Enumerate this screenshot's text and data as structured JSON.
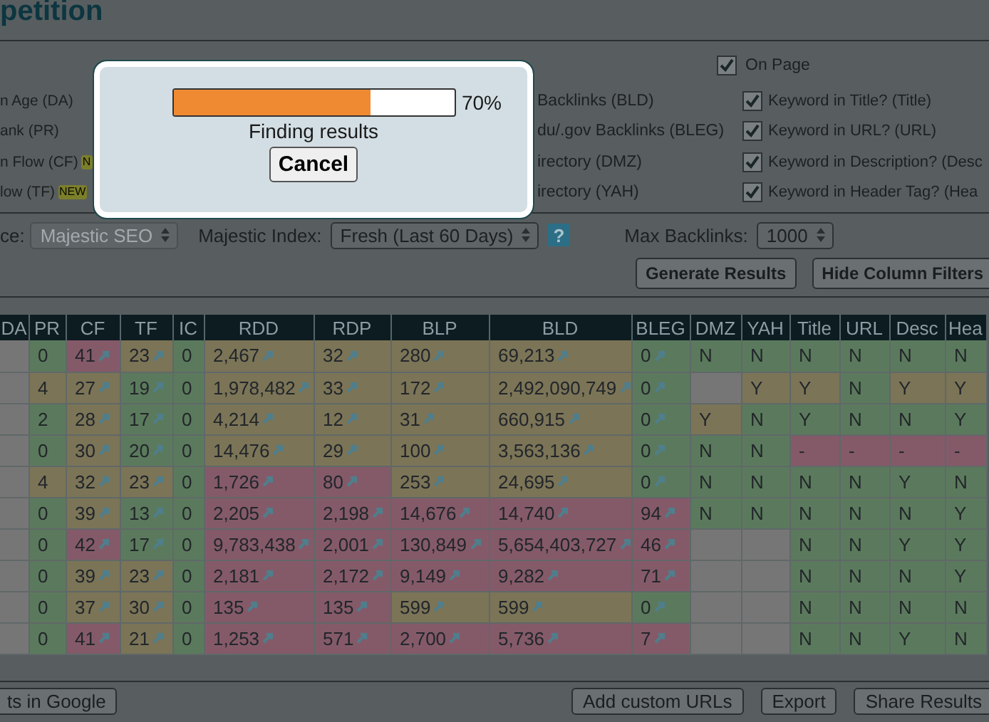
{
  "page": {
    "title": "petition"
  },
  "options": {
    "column_1": [
      {
        "label": "n Age (DA)"
      },
      {
        "label": "ank (PR)"
      },
      {
        "label": "n Flow (CF)",
        "badge": "N"
      },
      {
        "label": "low (TF)",
        "badge": "NEW"
      }
    ],
    "column_2": [
      {
        "label": "Backlinks (BLD)"
      },
      {
        "label": "du/.gov Backlinks (BLEG)"
      },
      {
        "label": "irectory (DMZ)"
      },
      {
        "label": "irectory (YAH)"
      }
    ],
    "on_page": {
      "label": "On Page",
      "checked": true,
      "items": [
        {
          "label": "Keyword in Title? (Title)",
          "checked": true
        },
        {
          "label": "Keyword in URL? (URL)",
          "checked": true
        },
        {
          "label": "Keyword in Description? (Desc",
          "checked": true
        },
        {
          "label": "Keyword in Header Tag? (Hea",
          "checked": true
        }
      ]
    }
  },
  "controls": {
    "source_label": "ce:",
    "source": {
      "value": "Majestic SEO",
      "disabled": true
    },
    "index_label": "Majestic Index:",
    "index": {
      "value": "Fresh (Last 60 Days)",
      "disabled": false
    },
    "help": "?",
    "max_label": "Max Backlinks:",
    "max": {
      "value": "1000",
      "disabled": false
    },
    "buttons": [
      "Generate Results",
      "Hide Column Filters"
    ]
  },
  "table": {
    "columns": [
      {
        "label": "DA"
      },
      {
        "label": "PR",
        "kind": "plain"
      },
      {
        "label": "CF",
        "kind": "link"
      },
      {
        "label": "TF",
        "kind": "link"
      },
      {
        "label": "IC",
        "kind": "plain"
      },
      {
        "label": "RDD",
        "kind": "link"
      },
      {
        "label": "RDP",
        "kind": "link"
      },
      {
        "label": "BLP",
        "kind": "link"
      },
      {
        "label": "BLD",
        "kind": "link"
      },
      {
        "label": "BLEG",
        "kind": "link"
      },
      {
        "label": "DMZ",
        "kind": "plain"
      },
      {
        "label": "YAH",
        "kind": "plain"
      },
      {
        "label": "Title",
        "kind": "plain"
      },
      {
        "label": "URL",
        "kind": "plain"
      },
      {
        "label": "Desc",
        "kind": "plain"
      },
      {
        "label": "Hea",
        "kind": "plain"
      }
    ],
    "rows": [
      {
        "cells": [
          {
            "color": "#767676"
          },
          {
            "text": "0",
            "color": "#5b7a5d"
          },
          {
            "text": "41",
            "color": "#845a69"
          },
          {
            "text": "23",
            "color": "#7b7457"
          },
          {
            "text": "0",
            "color": "#5b7a5d"
          },
          {
            "text": "2,467",
            "color": "#7b7457"
          },
          {
            "text": "32",
            "color": "#7b7457"
          },
          {
            "text": "280",
            "color": "#7b7457"
          },
          {
            "text": "69,213",
            "color": "#7b7457"
          },
          {
            "text": "0",
            "color": "#5b7a5d"
          },
          {
            "text": "N",
            "color": "#5b7a5d"
          },
          {
            "text": "N",
            "color": "#5b7a5d"
          },
          {
            "text": "N",
            "color": "#5b7a5d"
          },
          {
            "text": "N",
            "color": "#5b7a5d"
          },
          {
            "text": "N",
            "color": "#5b7a5d"
          },
          {
            "text": "N",
            "color": "#5b7a5d"
          }
        ]
      },
      {
        "cells": [
          {
            "color": "#767676"
          },
          {
            "text": "4",
            "color": "#7b7457"
          },
          {
            "text": "27",
            "color": "#7b7457"
          },
          {
            "text": "19",
            "color": "#5b7a5d"
          },
          {
            "text": "0",
            "color": "#5b7a5d"
          },
          {
            "text": "1,978,482",
            "color": "#7b7457"
          },
          {
            "text": "33",
            "color": "#7b7457"
          },
          {
            "text": "172",
            "color": "#7b7457"
          },
          {
            "text": "2,492,090,749",
            "color": "#7b7457"
          },
          {
            "text": "0",
            "color": "#5b7a5d"
          },
          {
            "color": "#767676"
          },
          {
            "text": "Y",
            "color": "#7b7457"
          },
          {
            "text": "Y",
            "color": "#7b7457"
          },
          {
            "text": "N",
            "color": "#5b7a5d"
          },
          {
            "text": "Y",
            "color": "#7b7457"
          },
          {
            "text": "Y",
            "color": "#7b7457"
          }
        ]
      },
      {
        "cells": [
          {
            "color": "#767676"
          },
          {
            "text": "2",
            "color": "#5b7a5d"
          },
          {
            "text": "28",
            "color": "#7b7457"
          },
          {
            "text": "17",
            "color": "#5b7a5d"
          },
          {
            "text": "0",
            "color": "#5b7a5d"
          },
          {
            "text": "4,214",
            "color": "#7b7457"
          },
          {
            "text": "12",
            "color": "#7b7457"
          },
          {
            "text": "31",
            "color": "#7b7457"
          },
          {
            "text": "660,915",
            "color": "#7b7457"
          },
          {
            "text": "0",
            "color": "#5b7a5d"
          },
          {
            "text": "Y",
            "color": "#7b7457"
          },
          {
            "text": "N",
            "color": "#5b7a5d"
          },
          {
            "text": "Y",
            "color": "#5b7a5d"
          },
          {
            "text": "N",
            "color": "#5b7a5d"
          },
          {
            "text": "N",
            "color": "#5b7a5d"
          },
          {
            "text": "Y",
            "color": "#5b7a5d"
          }
        ]
      },
      {
        "cells": [
          {
            "color": "#767676"
          },
          {
            "text": "0",
            "color": "#5b7a5d"
          },
          {
            "text": "30",
            "color": "#7b7457"
          },
          {
            "text": "20",
            "color": "#5b7a5d"
          },
          {
            "text": "0",
            "color": "#5b7a5d"
          },
          {
            "text": "14,476",
            "color": "#7b7457"
          },
          {
            "text": "29",
            "color": "#7b7457"
          },
          {
            "text": "100",
            "color": "#7b7457"
          },
          {
            "text": "3,563,136",
            "color": "#7b7457"
          },
          {
            "text": "0",
            "color": "#5b7a5d"
          },
          {
            "text": "N",
            "color": "#5b7a5d"
          },
          {
            "text": "N",
            "color": "#5b7a5d"
          },
          {
            "text": "-",
            "color": "#845a69"
          },
          {
            "text": "-",
            "color": "#845a69"
          },
          {
            "text": "-",
            "color": "#845a69"
          },
          {
            "text": "-",
            "color": "#845a69"
          }
        ]
      },
      {
        "cells": [
          {
            "color": "#767676"
          },
          {
            "text": "4",
            "color": "#7b7457"
          },
          {
            "text": "32",
            "color": "#7b7457"
          },
          {
            "text": "23",
            "color": "#7b7457"
          },
          {
            "text": "0",
            "color": "#5b7a5d"
          },
          {
            "text": "1,726",
            "color": "#845a69"
          },
          {
            "text": "80",
            "color": "#845a69"
          },
          {
            "text": "253",
            "color": "#7b7457"
          },
          {
            "text": "24,695",
            "color": "#7b7457"
          },
          {
            "text": "0",
            "color": "#5b7a5d"
          },
          {
            "text": "N",
            "color": "#5b7a5d"
          },
          {
            "text": "N",
            "color": "#5b7a5d"
          },
          {
            "text": "N",
            "color": "#5b7a5d"
          },
          {
            "text": "N",
            "color": "#5b7a5d"
          },
          {
            "text": "Y",
            "color": "#5b7a5d"
          },
          {
            "text": "N",
            "color": "#5b7a5d"
          }
        ]
      },
      {
        "cells": [
          {
            "color": "#767676"
          },
          {
            "text": "0",
            "color": "#5b7a5d"
          },
          {
            "text": "39",
            "color": "#7b7457"
          },
          {
            "text": "13",
            "color": "#5b7a5d"
          },
          {
            "text": "0",
            "color": "#5b7a5d"
          },
          {
            "text": "2,205",
            "color": "#845a69"
          },
          {
            "text": "2,198",
            "color": "#845a69"
          },
          {
            "text": "14,676",
            "color": "#845a69"
          },
          {
            "text": "14,740",
            "color": "#845a69"
          },
          {
            "text": "94",
            "color": "#845a69"
          },
          {
            "text": "N",
            "color": "#5b7a5d"
          },
          {
            "text": "N",
            "color": "#5b7a5d"
          },
          {
            "text": "N",
            "color": "#5b7a5d"
          },
          {
            "text": "N",
            "color": "#5b7a5d"
          },
          {
            "text": "N",
            "color": "#5b7a5d"
          },
          {
            "text": "Y",
            "color": "#5b7a5d"
          }
        ]
      },
      {
        "cells": [
          {
            "color": "#767676"
          },
          {
            "text": "0",
            "color": "#5b7a5d"
          },
          {
            "text": "42",
            "color": "#845a69"
          },
          {
            "text": "17",
            "color": "#5b7a5d"
          },
          {
            "text": "0",
            "color": "#5b7a5d"
          },
          {
            "text": "9,783,438",
            "color": "#845a69"
          },
          {
            "text": "2,001",
            "color": "#845a69"
          },
          {
            "text": "130,849",
            "color": "#845a69"
          },
          {
            "text": "5,654,403,727",
            "color": "#845a69"
          },
          {
            "text": "46",
            "color": "#845a69"
          },
          {
            "color": "#767676"
          },
          {
            "color": "#767676"
          },
          {
            "text": "N",
            "color": "#5b7a5d"
          },
          {
            "text": "N",
            "color": "#5b7a5d"
          },
          {
            "text": "Y",
            "color": "#5b7a5d"
          },
          {
            "text": "Y",
            "color": "#5b7a5d"
          }
        ]
      },
      {
        "cells": [
          {
            "color": "#767676"
          },
          {
            "text": "0",
            "color": "#5b7a5d"
          },
          {
            "text": "39",
            "color": "#7b7457"
          },
          {
            "text": "23",
            "color": "#7b7457"
          },
          {
            "text": "0",
            "color": "#5b7a5d"
          },
          {
            "text": "2,181",
            "color": "#845a69"
          },
          {
            "text": "2,172",
            "color": "#845a69"
          },
          {
            "text": "9,149",
            "color": "#845a69"
          },
          {
            "text": "9,282",
            "color": "#845a69"
          },
          {
            "text": "71",
            "color": "#845a69"
          },
          {
            "color": "#767676"
          },
          {
            "color": "#767676"
          },
          {
            "text": "N",
            "color": "#5b7a5d"
          },
          {
            "text": "N",
            "color": "#5b7a5d"
          },
          {
            "text": "N",
            "color": "#5b7a5d"
          },
          {
            "text": "Y",
            "color": "#5b7a5d"
          }
        ]
      },
      {
        "cells": [
          {
            "color": "#767676"
          },
          {
            "text": "0",
            "color": "#5b7a5d"
          },
          {
            "text": "37",
            "color": "#7b7457"
          },
          {
            "text": "30",
            "color": "#7b7457"
          },
          {
            "text": "0",
            "color": "#5b7a5d"
          },
          {
            "text": "135",
            "color": "#845a69"
          },
          {
            "text": "135",
            "color": "#845a69"
          },
          {
            "text": "599",
            "color": "#7b7457"
          },
          {
            "text": "599",
            "color": "#7b7457"
          },
          {
            "text": "0",
            "color": "#5b7a5d"
          },
          {
            "color": "#767676"
          },
          {
            "color": "#767676"
          },
          {
            "text": "N",
            "color": "#5b7a5d"
          },
          {
            "text": "N",
            "color": "#5b7a5d"
          },
          {
            "text": "N",
            "color": "#5b7a5d"
          },
          {
            "text": "N",
            "color": "#5b7a5d"
          }
        ]
      },
      {
        "cells": [
          {
            "color": "#767676"
          },
          {
            "text": "0",
            "color": "#5b7a5d"
          },
          {
            "text": "41",
            "color": "#845a69"
          },
          {
            "text": "21",
            "color": "#7b7457"
          },
          {
            "text": "0",
            "color": "#5b7a5d"
          },
          {
            "text": "1,253",
            "color": "#845a69"
          },
          {
            "text": "571",
            "color": "#845a69"
          },
          {
            "text": "2,700",
            "color": "#845a69"
          },
          {
            "text": "5,736",
            "color": "#845a69"
          },
          {
            "text": "7",
            "color": "#845a69"
          },
          {
            "color": "#767676"
          },
          {
            "color": "#767676"
          },
          {
            "text": "N",
            "color": "#5b7a5d"
          },
          {
            "text": "N",
            "color": "#5b7a5d"
          },
          {
            "text": "Y",
            "color": "#5b7a5d"
          },
          {
            "text": "N",
            "color": "#5b7a5d"
          }
        ]
      }
    ]
  },
  "footer": {
    "buttons": [
      "ts in Google",
      "Add custom URLs",
      "Export",
      "Share Results"
    ]
  },
  "dialog": {
    "level": 0.7,
    "percent": "70%",
    "message": "Finding results",
    "button": "Cancel"
  }
}
